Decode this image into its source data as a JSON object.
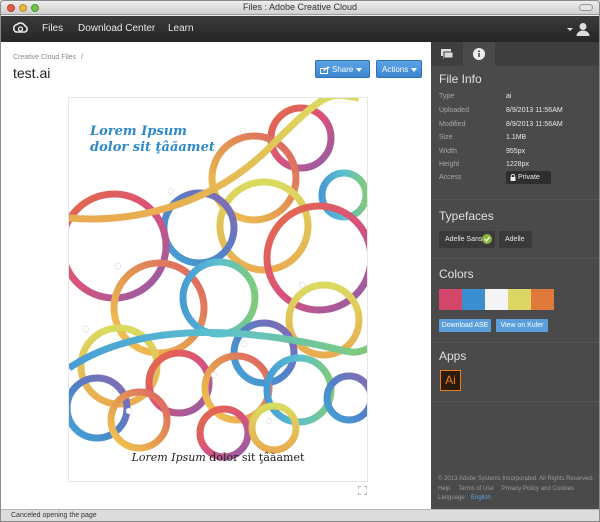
{
  "window": {
    "title": "Files : Adobe Creative Cloud"
  },
  "nav": {
    "items": [
      "Files",
      "Download Center",
      "Learn"
    ],
    "logo_icon": "creative-cloud-logo-icon",
    "user_icon": "user-icon"
  },
  "breadcrumb": {
    "label": "Creative Cloud Files",
    "separator": "/"
  },
  "file": {
    "name": "test.ai"
  },
  "toolbar": {
    "share_label": "Share",
    "actions_label": "Actions"
  },
  "preview": {
    "headline_line1": "Lorem Ipsum",
    "headline_line2": "dolor sit ţâăamet",
    "footer_italic": "Lorem Ipsum",
    "footer_rest": " dolor sit ţâăamet"
  },
  "sidebar": {
    "file_info": {
      "heading": "File Info",
      "rows": [
        {
          "label": "Type",
          "value": "ai"
        },
        {
          "label": "Uploaded",
          "value": "8/9/2013 11:56AM"
        },
        {
          "label": "Modified",
          "value": "8/9/2013 11:56AM"
        },
        {
          "label": "Size",
          "value": "1.1MB"
        },
        {
          "label": "Width",
          "value": "955px"
        },
        {
          "label": "Height",
          "value": "1228px"
        },
        {
          "label": "Access",
          "value": ""
        }
      ],
      "private_label": "Private"
    },
    "typefaces": {
      "heading": "Typefaces",
      "items": [
        "Adelle Sans",
        "Adelle"
      ]
    },
    "colors": {
      "heading": "Colors",
      "swatches": [
        "#d4476a",
        "#3b8ed0",
        "#f4f4f4",
        "#dcd664",
        "#e07a3a"
      ],
      "download_label": "Download ASE",
      "kuler_label": "View on Kuler"
    },
    "apps": {
      "heading": "Apps",
      "icon_text": "Ai"
    },
    "footer": {
      "copyright": "© 2013 Adobe Systems Incorporated. All Rights Reserved.",
      "links": [
        "Help",
        "Terms of Use",
        "Privacy Policy and Cookies"
      ],
      "language_label": "Language:",
      "language_value": "English"
    }
  },
  "status": {
    "text": "Canceled opening the page"
  },
  "colors": {
    "nav_bg": "#2b2b2b",
    "sidebar_bg": "#4a4a4a",
    "accent": "#4a94d9"
  }
}
